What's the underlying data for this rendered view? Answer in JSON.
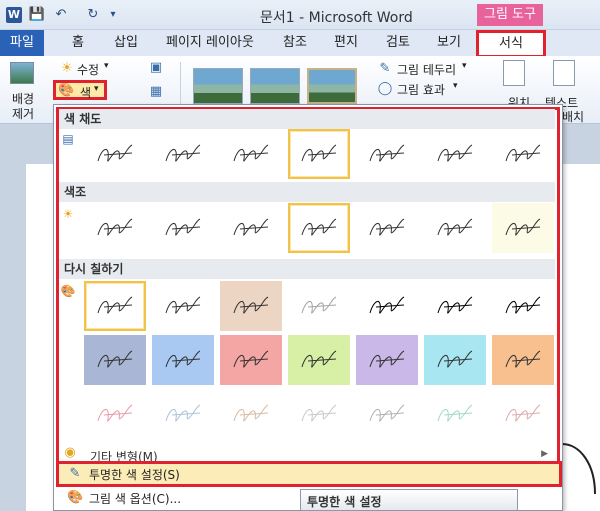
{
  "window": {
    "title": "문서1  -  Microsoft Word",
    "context_tab_group": "그림 도구",
    "qat": [
      "save-icon",
      "undo-icon",
      "redo-icon",
      "customize-icon"
    ]
  },
  "tabs": {
    "file": "파일",
    "items": [
      "홈",
      "삽입",
      "페이지 레이아웃",
      "참조",
      "편지",
      "검토",
      "보기"
    ],
    "format": "서식"
  },
  "ribbon": {
    "remove_bg": "배경\n제거",
    "corrections": "수정",
    "color": "색",
    "picture_border": "그림 테두리",
    "picture_effects": "그림 효과",
    "position": "위치",
    "wrap_text": "텍스트",
    "wrap_text_2": "배치"
  },
  "gallery": {
    "sections": [
      {
        "title": "색 채도",
        "count": 7
      },
      {
        "title": "색조",
        "count": 7
      },
      {
        "title": "다시 칠하기",
        "count": 21
      }
    ],
    "recolor_fills": [
      "#ffffff",
      "#ffffff",
      "#ecd5c3",
      "#ffffff",
      "#ffffff",
      "#ffffff",
      "#ffffff",
      "#aab6d6",
      "#a9c9f2",
      "#f4a6a4",
      "#d8f0a6",
      "#c9b8e8",
      "#a8e6f2",
      "#f8c08e",
      "#ffffff",
      "#ffffff",
      "#ffffff",
      "#ffffff",
      "#ffffff",
      "#ffffff",
      "#ffffff"
    ],
    "more_variations": "기타 변형(M)",
    "set_transparent": "투명한 색 설정(S)",
    "color_options": "그림 색 옵션(C)..."
  },
  "tooltip": "투명한 색 설정"
}
